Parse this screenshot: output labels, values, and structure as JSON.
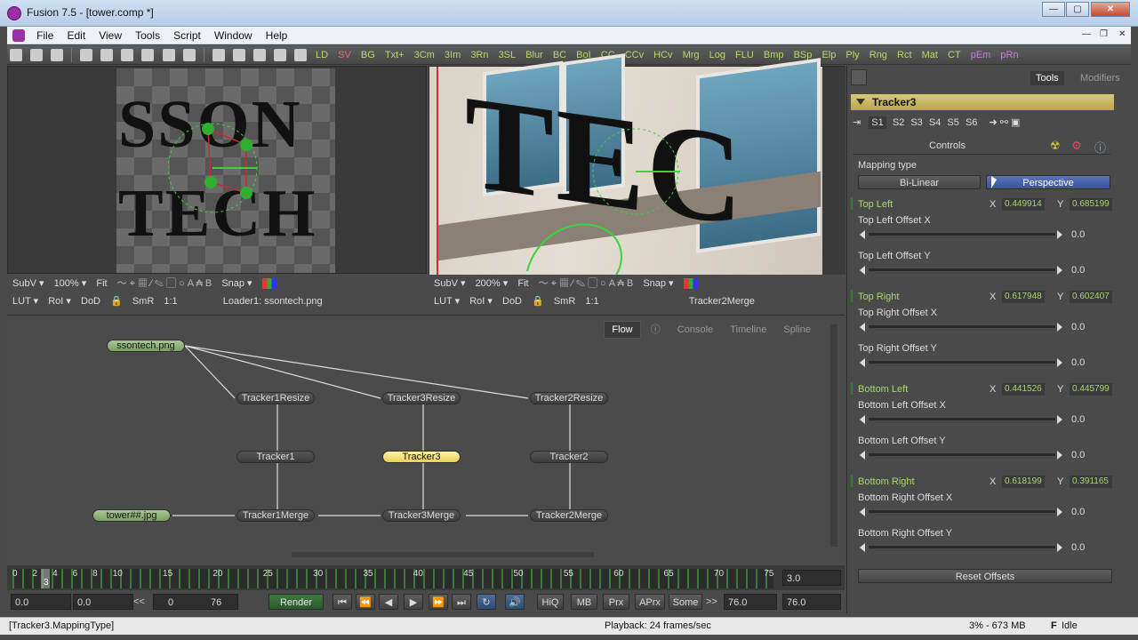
{
  "window": {
    "title": "Fusion 7.5 - [tower.comp *]",
    "min": "—",
    "max": "▢",
    "close": "✕"
  },
  "menu": {
    "items": [
      "File",
      "Edit",
      "View",
      "Tools",
      "Script",
      "Window",
      "Help"
    ]
  },
  "mdi": {
    "min": "—",
    "restore": "❐",
    "close": "✕"
  },
  "toolbar": {
    "tools": [
      "LD",
      "SV",
      "BG",
      "Txt+",
      "3Cm",
      "3Im",
      "3Rn",
      "3SL",
      "Blur",
      "BC",
      "BoI",
      "CC",
      "CCv",
      "HCv",
      "Mrg",
      "Log",
      "FLU",
      "Bmp",
      "BSp",
      "Elp",
      "Ply",
      "Rng",
      "Rct",
      "Mat",
      "CT",
      "pEm",
      "pRn"
    ]
  },
  "viewer1": {
    "text1": "SSON",
    "text2": "TECH",
    "bar1": [
      "SubV ▾",
      "100% ▾",
      "Fit",
      "Snap ▾"
    ],
    "bar2": [
      "LUT ▾",
      "RoI ▾",
      "DoD",
      "SmR",
      "1:1"
    ],
    "name": "Loader1: ssontech.png"
  },
  "viewer2": {
    "text": "TEC",
    "bar1": [
      "SubV ▾",
      "200% ▾",
      "Fit",
      "Snap ▾"
    ],
    "bar2": [
      "LUT ▾",
      "RoI ▾",
      "DoD",
      "SmR",
      "1:1"
    ],
    "name": "Tracker2Merge"
  },
  "flow": {
    "tabs": [
      "Flow",
      "Console",
      "Timeline",
      "Spline"
    ],
    "nodes": {
      "loader": "ssontech.png",
      "tr1resize": "Tracker1Resize",
      "tr3resize": "Tracker3Resize",
      "tr2resize": "Tracker2Resize",
      "tr1": "Tracker1",
      "tr3": "Tracker3",
      "tr2": "Tracker2",
      "tower": "tower##.jpg",
      "m1": "Tracker1Merge",
      "m3": "Tracker3Merge",
      "m2": "Tracker2Merge"
    }
  },
  "timeline": {
    "ticks": [
      "0",
      "2",
      "4",
      "6",
      "8",
      "10",
      "15",
      "20",
      "25",
      "30",
      "35",
      "40",
      "45",
      "50",
      "55",
      "60",
      "65",
      "70",
      "75"
    ],
    "current": "3",
    "end_field": "3.0"
  },
  "transport": {
    "start": "0.0",
    "start2": "0.0",
    "range_start": "0",
    "range_end": "76",
    "render": "Render",
    "hiq": "HiQ",
    "mb": "MB",
    "prx": "Prx",
    "aprx": "APrx",
    "some": "Some",
    "end": "76.0",
    "end2": "76.0",
    "arrows": ">>",
    "back": "<<"
  },
  "status": {
    "left": "[Tracker3.MappingType]",
    "playback": "Playback: 24 frames/sec",
    "mem": "3% - 673 MB",
    "state": "Idle"
  },
  "panel": {
    "tabs": [
      "Tools",
      "Modifiers"
    ],
    "tool": "Tracker3",
    "subtabs": [
      "S1",
      "S2",
      "S3",
      "S4",
      "S5",
      "S6"
    ],
    "section": "Controls",
    "mapping_label": "Mapping type",
    "bilinear": "Bi-Linear",
    "perspective": "Perspective",
    "corners": [
      {
        "name": "Top Left",
        "x": "0.449914",
        "y": "0.685199",
        "ox_label": "Top Left Offset X",
        "ox": "0.0",
        "oy_label": "Top Left Offset Y",
        "oy": "0.0"
      },
      {
        "name": "Top Right",
        "x": "0.617948",
        "y": "0.602407",
        "ox_label": "Top Right Offset X",
        "ox": "0.0",
        "oy_label": "Top Right Offset Y",
        "oy": "0.0"
      },
      {
        "name": "Bottom Left",
        "x": "0.441526",
        "y": "0.445799",
        "ox_label": "Bottom Left Offset X",
        "ox": "0.0",
        "oy_label": "Bottom Left Offset Y",
        "oy": "0.0"
      },
      {
        "name": "Bottom Right",
        "x": "0.618199",
        "y": "0.391165",
        "ox_label": "Bottom Right Offset X",
        "ox": "0.0",
        "oy_label": "Bottom Right Offset Y",
        "oy": "0.0"
      }
    ],
    "xlabel": "X",
    "ylabel": "Y",
    "reset": "Reset Offsets"
  },
  "colors": {
    "accent_green": "#a9d96e",
    "tool_header": "#d9c977",
    "perspective_blue": "#4a62ac"
  }
}
